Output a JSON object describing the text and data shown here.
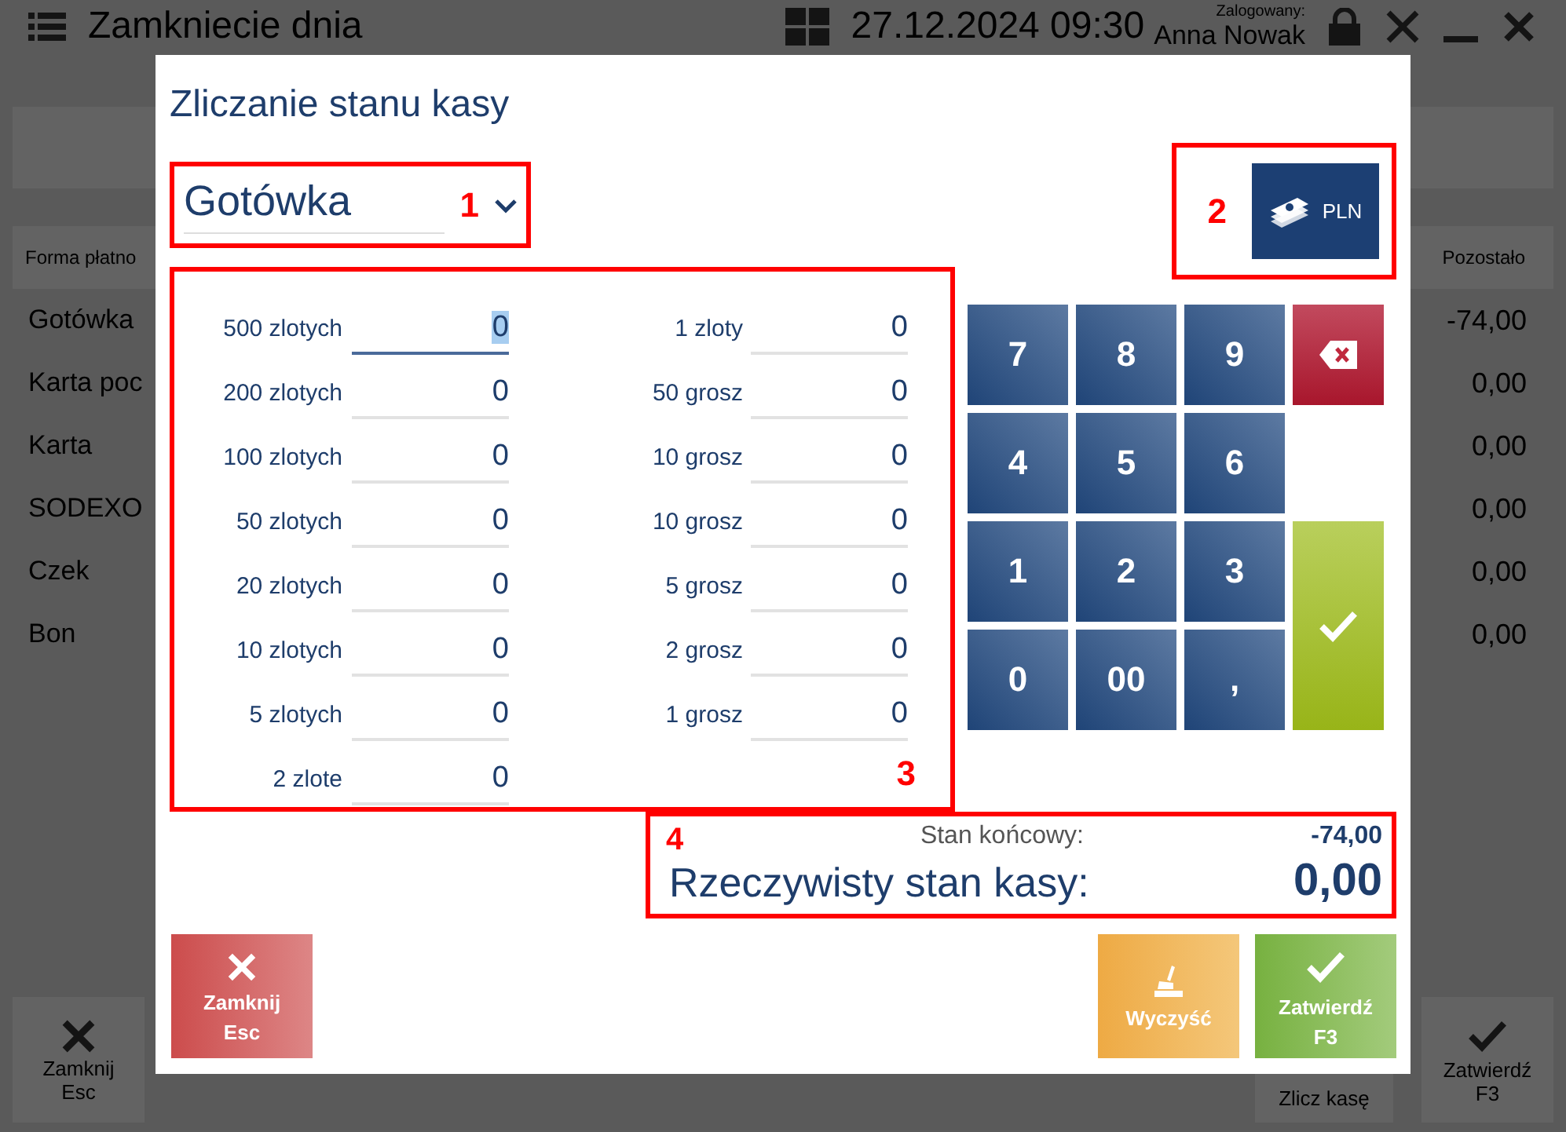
{
  "app": {
    "title": "Zamkniecie dnia",
    "datetime": "27.12.2024 09:30",
    "login_label": "Zalogowany:",
    "user": "Anna Nowak"
  },
  "table": {
    "columns": [
      "Forma płatno",
      "Pozostało"
    ],
    "rows": [
      {
        "method": "Gotówka",
        "remaining": "-74,00"
      },
      {
        "method": "Karta poc",
        "remaining": "0,00"
      },
      {
        "method": "Karta",
        "remaining": "0,00"
      },
      {
        "method": "SODEXO",
        "remaining": "0,00"
      },
      {
        "method": "Czek",
        "remaining": "0,00"
      },
      {
        "method": "Bon",
        "remaining": "0,00"
      }
    ]
  },
  "footer_buttons": [
    {
      "kind": "close",
      "label": "Zamknij",
      "shortcut": "Esc"
    },
    {
      "kind": "count",
      "label": "Zlicz kasę"
    },
    {
      "kind": "confirm",
      "label": "Zatwierdź",
      "shortcut": "F3"
    }
  ],
  "dialog": {
    "title": "Zliczanie stanu kasy",
    "payment_method": "Gotówka",
    "currency": "PLN",
    "denomination_columns": [
      [
        {
          "label": "500 zlotych",
          "value": "0",
          "focused": true
        },
        {
          "label": "200 zlotych",
          "value": "0",
          "focused": false
        },
        {
          "label": "100 zlotych",
          "value": "0",
          "focused": false
        },
        {
          "label": "50 zlotych",
          "value": "0",
          "focused": false
        },
        {
          "label": "20 zlotych",
          "value": "0",
          "focused": false
        },
        {
          "label": "10 zlotych",
          "value": "0",
          "focused": false
        },
        {
          "label": "5 zlotych",
          "value": "0",
          "focused": false
        },
        {
          "label": "2 zlote",
          "value": "0",
          "focused": false
        }
      ],
      [
        {
          "label": "1 zloty",
          "value": "0",
          "focused": false
        },
        {
          "label": "50 grosz",
          "value": "0",
          "focused": false
        },
        {
          "label": "10 grosz",
          "value": "0",
          "focused": false
        },
        {
          "label": "10 grosz",
          "value": "0",
          "focused": false
        },
        {
          "label": "5 grosz",
          "value": "0",
          "focused": false
        },
        {
          "label": "2 grosz",
          "value": "0",
          "focused": false
        },
        {
          "label": "1 grosz",
          "value": "0",
          "focused": false
        }
      ]
    ],
    "keypad": [
      {
        "kind": "digit",
        "label": "7"
      },
      {
        "kind": "digit",
        "label": "8"
      },
      {
        "kind": "digit",
        "label": "9"
      },
      {
        "kind": "backspace"
      },
      {
        "kind": "digit",
        "label": "4"
      },
      {
        "kind": "digit",
        "label": "5"
      },
      {
        "kind": "digit",
        "label": "6"
      },
      {
        "kind": "digit",
        "label": "1"
      },
      {
        "kind": "digit",
        "label": "2"
      },
      {
        "kind": "digit",
        "label": "3"
      },
      {
        "kind": "enter"
      },
      {
        "kind": "digit",
        "label": "0"
      },
      {
        "kind": "digit",
        "label": "00"
      },
      {
        "kind": "digit",
        "label": ","
      }
    ],
    "summary": {
      "expected_label": "Stan końcowy:",
      "expected": "-74,00",
      "actual_label": "Rzeczywisty stan kasy:",
      "actual": "0,00"
    },
    "buttons": [
      {
        "kind": "close",
        "label": "Zamknij",
        "shortcut": "Esc"
      },
      {
        "kind": "clear",
        "label": "Wyczyść"
      },
      {
        "kind": "confirm",
        "label": "Zatwierdź",
        "shortcut": "F3"
      }
    ]
  },
  "annotations": [
    "1",
    "2",
    "3",
    "4"
  ]
}
